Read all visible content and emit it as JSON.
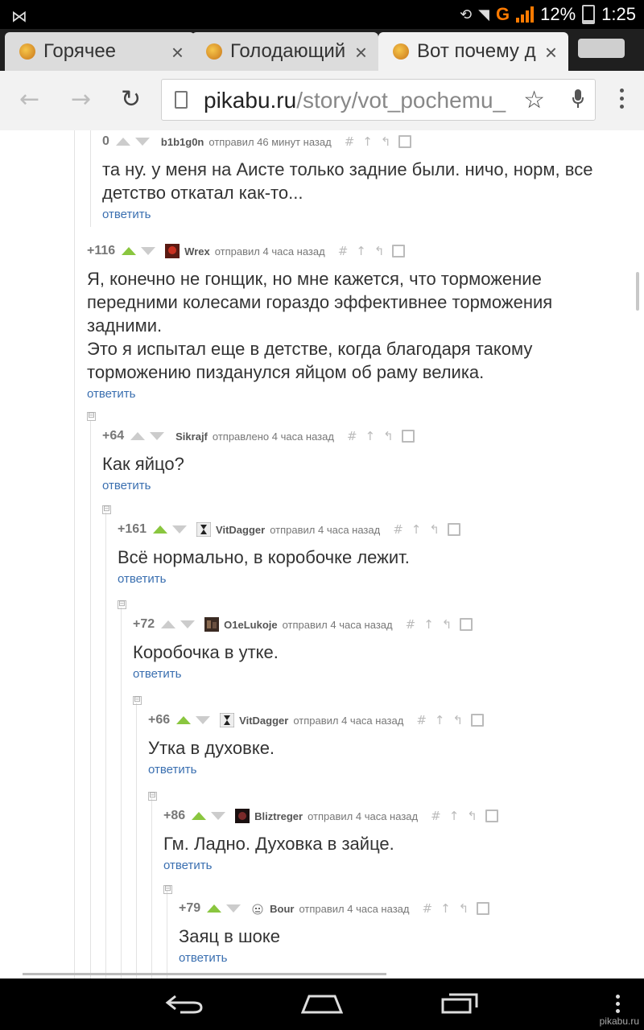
{
  "status_bar": {
    "network": "G",
    "battery": "12%",
    "time": "1:25"
  },
  "tabs": [
    {
      "title": "Горячее",
      "close": "×"
    },
    {
      "title": "Голодающий",
      "close": "×"
    },
    {
      "title": "Вот почему д",
      "close": "×"
    }
  ],
  "toolbar": {
    "back_icon": "arrow-left",
    "forward_icon": "arrow-right",
    "reload_icon": "reload",
    "url_host": "pikabu.ru",
    "url_path": "/story/vot_pochemu_",
    "star_icon": "star",
    "mic_icon": "microphone",
    "menu_icon": "overflow-menu"
  },
  "comments": [
    {
      "score": "0",
      "author": "b1b1g0n",
      "sent": "отправил 46 минут назад",
      "text": "та ну. у меня на Аисте только задние были. ничо, норм, все детство откатал как-то...",
      "reply": "ответить",
      "upvoted": false
    },
    {
      "score": "+116",
      "author": "Wrex",
      "sent": "отправил 4 часа назад",
      "text": "Я, конечно не гонщик, но мне кажется, что торможение передними колесами гораздо эффективнее торможения задними.\nЭто я испытал еще в детстве, когда благодаря такому торможению пизданулся яйцом об раму велика.",
      "reply": "ответить",
      "upvoted": true
    },
    {
      "score": "+64",
      "author": "Sikrajf",
      "sent": "отправлено 4 часа назад",
      "text": "Как яйцо?",
      "reply": "ответить",
      "upvoted": false
    },
    {
      "score": "+161",
      "author": "VitDagger",
      "sent": "отправил 4 часа назад",
      "text": "Всё нормально, в коробочке лежит.",
      "reply": "ответить",
      "upvoted": true
    },
    {
      "score": "+72",
      "author": "O1eLukoje",
      "sent": "отправил 4 часа назад",
      "text": "Коробочка в утке.",
      "reply": "ответить",
      "upvoted": false
    },
    {
      "score": "+66",
      "author": "VitDagger",
      "sent": "отправил 4 часа назад",
      "text": "Утка в духовке.",
      "reply": "ответить",
      "upvoted": true
    },
    {
      "score": "+86",
      "author": "Bliztreger",
      "sent": "отправил 4 часа назад",
      "text": "Гм. Ладно. Духовка в зайце.",
      "reply": "ответить",
      "upvoted": true
    },
    {
      "score": "+79",
      "author": "Bour",
      "sent": "отправил 4 часа назад",
      "text": "Заяц в шоке",
      "reply": "ответить",
      "upvoted": true
    }
  ],
  "comment_tools": {
    "hash": "#",
    "up": "↑",
    "parent": "↰"
  },
  "collapse_symbol": "⊟",
  "nav_bar": {
    "back_icon": "back",
    "home_icon": "home",
    "recents_icon": "recents",
    "menu_icon": "menu"
  },
  "watermark": "pikabu.ru"
}
